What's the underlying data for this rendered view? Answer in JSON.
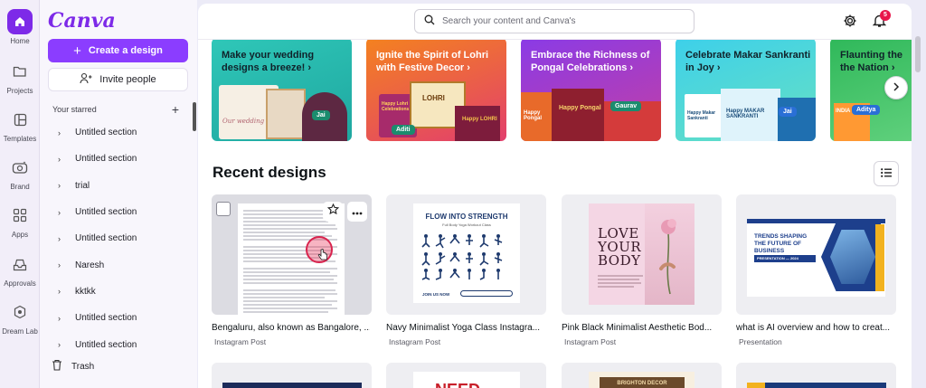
{
  "rail": {
    "items": [
      {
        "label": "Home",
        "icon": "home-icon"
      },
      {
        "label": "Projects",
        "icon": "folder-icon"
      },
      {
        "label": "Templates",
        "icon": "templates-icon"
      },
      {
        "label": "Brand",
        "icon": "brand-icon"
      },
      {
        "label": "Apps",
        "icon": "apps-icon"
      },
      {
        "label": "Approvals",
        "icon": "approvals-icon"
      },
      {
        "label": "Dream Lab",
        "icon": "dream-lab-icon"
      }
    ]
  },
  "sidebar": {
    "logo": "Canva",
    "create_label": "Create a design",
    "invite_label": "Invite people",
    "starred_label": "Your starred",
    "sections": [
      "Untitled section",
      "Untitled section",
      "trial",
      "Untitled section",
      "Untitled section",
      "Naresh",
      "kktkk",
      "Untitled section",
      "Untitled section"
    ],
    "trash_label": "Trash"
  },
  "search": {
    "placeholder": "Search your content and Canva's"
  },
  "notifications": {
    "count": "5"
  },
  "banners": [
    {
      "title": "Make your wedding designs a breeze! ›",
      "tag": "Jai",
      "sub": "Our wedding"
    },
    {
      "title": "Ignite the Spirit of Lohri with Festive Decor ›",
      "tag": "Aditi",
      "sub": "Happy Lohri Celebrations",
      "sub2": "LOHRI",
      "sub3": "Happy LOHRI"
    },
    {
      "title": "Embrace the Richness of Pongal Celebrations ›",
      "tag": "Gaurav",
      "sub": "Happy Pongal",
      "sub2": "Happy Pongal"
    },
    {
      "title": "Celebrate Makar Sankranti in Joy ›",
      "tag": "Jai",
      "sub": "Happy Makar Sankranti",
      "sub2": "Happy MAKAR SANKRANTI"
    },
    {
      "title": "Flaunting the the Nation ›",
      "tag": "Aditya",
      "sub": "INDIA"
    }
  ],
  "recent": {
    "title": "Recent designs",
    "cards": [
      {
        "name": "Bengaluru, also known as Bangalore, ...",
        "type": "Instagram Post"
      },
      {
        "name": "Navy Minimalist Yoga Class Instagra...",
        "type": "Instagram Post",
        "thumb_title": "FLOW INTO STRENGTH",
        "thumb_sub": "Full Body Yoga Workout Class",
        "thumb_foot": "JOIN US NOW"
      },
      {
        "name": "Pink Black Minimalist Aesthetic Bod...",
        "type": "Instagram Post",
        "thumb_title": "LOVE YOUR BODY"
      },
      {
        "name": "what is AI overview and how to creat...",
        "type": "Presentation",
        "thumb_title": "TRENDS SHAPING THE FUTURE OF BUSINESS",
        "thumb_sub": "PRESENTATION — 2024"
      }
    ],
    "bottom": [
      {
        "text": ""
      },
      {
        "text": "NEED"
      },
      {
        "text": "BRIGHTON DECOR"
      },
      {
        "text": ""
      }
    ]
  }
}
